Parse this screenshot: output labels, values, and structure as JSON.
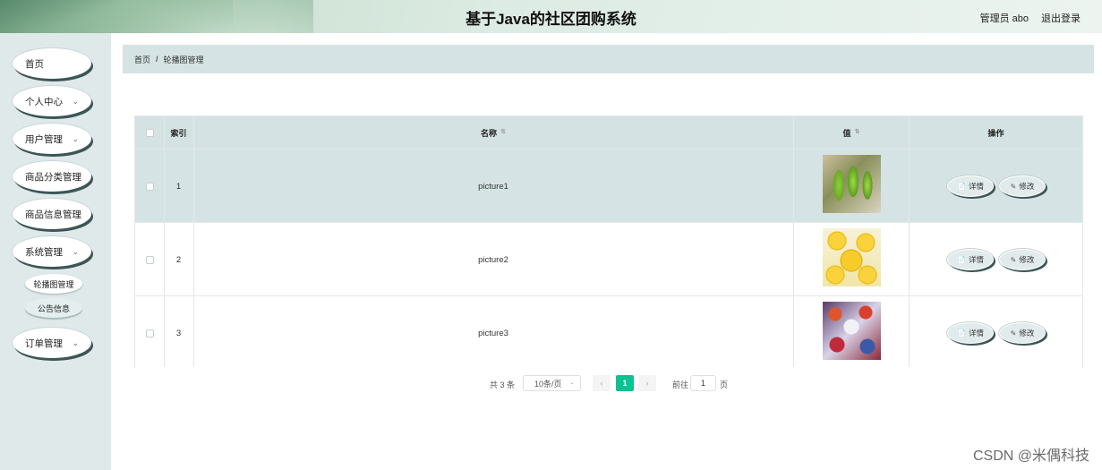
{
  "header": {
    "title": "基于Java的社区团购系统",
    "user": "管理员 abo",
    "logout": "退出登录"
  },
  "sidebar": {
    "items": [
      {
        "label": "首页",
        "chevron": false
      },
      {
        "label": "个人中心",
        "chevron": true
      },
      {
        "label": "用户管理",
        "chevron": true
      },
      {
        "label": "商品分类管理",
        "chevron": true
      },
      {
        "label": "商品信息管理",
        "chevron": true
      },
      {
        "label": "系统管理",
        "chevron": true
      },
      {
        "label": "订单管理",
        "chevron": true
      }
    ],
    "sub_items": [
      {
        "label": "轮播图管理",
        "active": true
      },
      {
        "label": "公告信息",
        "active": false
      }
    ],
    "chevron_glyph": "⌄"
  },
  "breadcrumb": {
    "home": "首页",
    "separator": "/",
    "current": "轮播图管理"
  },
  "table": {
    "columns": {
      "index": "索引",
      "name": "名称",
      "value": "值",
      "actions": "操作"
    },
    "sort_glyph": "⇅",
    "rows": [
      {
        "index": "1",
        "name": "picture1",
        "image": "green-fruit-photo"
      },
      {
        "index": "2",
        "name": "picture2",
        "image": "lemon-slices-photo"
      },
      {
        "index": "3",
        "name": "picture3",
        "image": "colorful-pattern-photo"
      }
    ],
    "detail_label": "详情",
    "edit_label": "修改",
    "detail_icon": "📄",
    "edit_icon": "✎"
  },
  "pagination": {
    "total": "共 3 条",
    "page_size": "10条/页",
    "prev": "‹",
    "current": "1",
    "next": "›",
    "goto_label": "前往",
    "goto_value": "1",
    "page_suffix": "页",
    "dropdown_glyph": "⌄"
  },
  "watermark": "CSDN @米偶科技",
  "colors": {
    "accent": "#0ec191",
    "breadcrumb_bg": "#d5e3e4",
    "sidebar_bg": "#dfe9ea",
    "button_shadow": "#3d5556"
  }
}
